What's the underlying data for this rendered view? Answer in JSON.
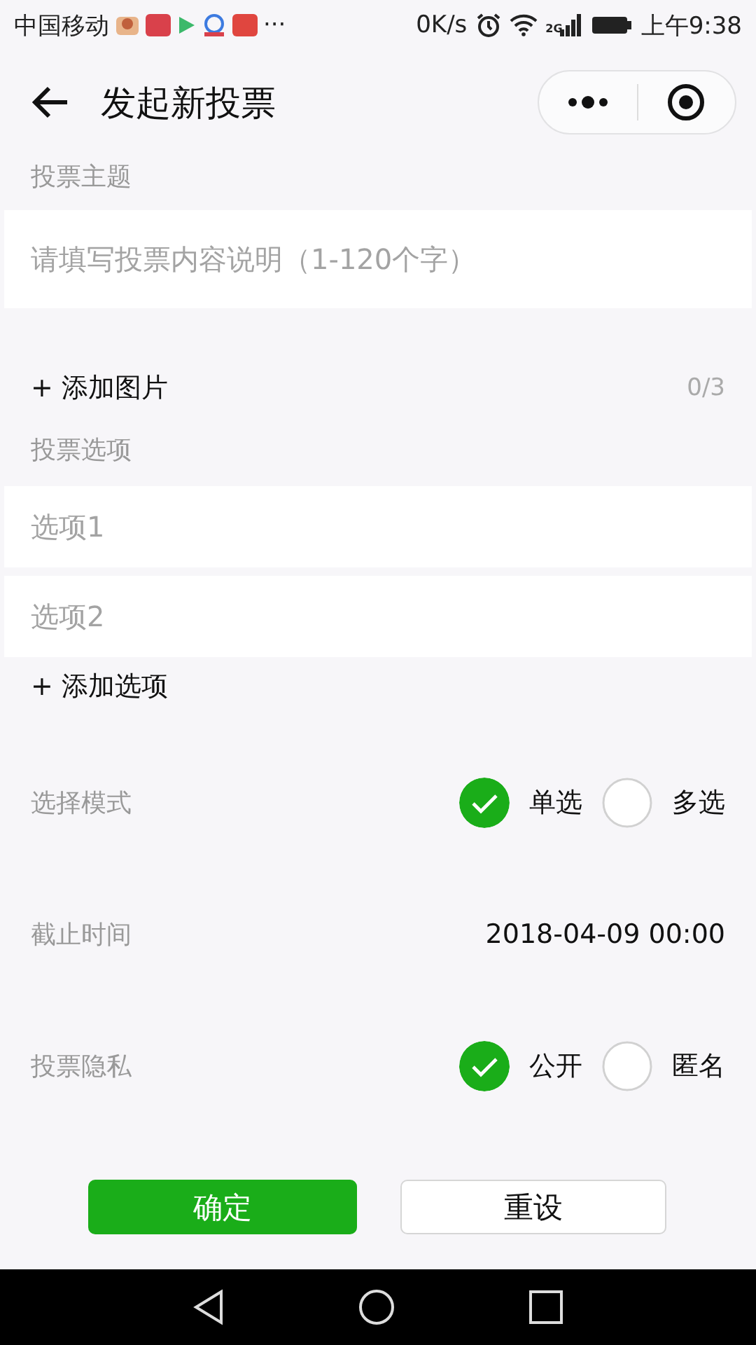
{
  "status_bar": {
    "carrier": "中国移动",
    "more": "···",
    "speed": "0K/s",
    "network": "2G",
    "time": "上午9:38"
  },
  "header": {
    "title": "发起新投票"
  },
  "topic": {
    "label": "投票主题",
    "placeholder": "请填写投票内容说明（1-120个字）"
  },
  "images": {
    "action": "+ 添加图片",
    "count": "0/3"
  },
  "options": {
    "label": "投票选项",
    "items": [
      {
        "placeholder": "选项1"
      },
      {
        "placeholder": "选项2"
      }
    ],
    "action": "+ 添加选项"
  },
  "settings": [
    {
      "kind": "radio",
      "label": "选择模式",
      "choices": [
        {
          "label": "单选",
          "selected": true
        },
        {
          "label": "多选",
          "selected": false
        }
      ]
    },
    {
      "kind": "value",
      "label": "截止时间",
      "value": "2018-04-09 00:00"
    },
    {
      "kind": "radio",
      "label": "投票隐私",
      "choices": [
        {
          "label": "公开",
          "selected": true
        },
        {
          "label": "匿名",
          "selected": false
        }
      ]
    }
  ],
  "buttons": [
    {
      "label": "确定",
      "kind": "primary"
    },
    {
      "label": "重设",
      "kind": "secondary"
    }
  ]
}
